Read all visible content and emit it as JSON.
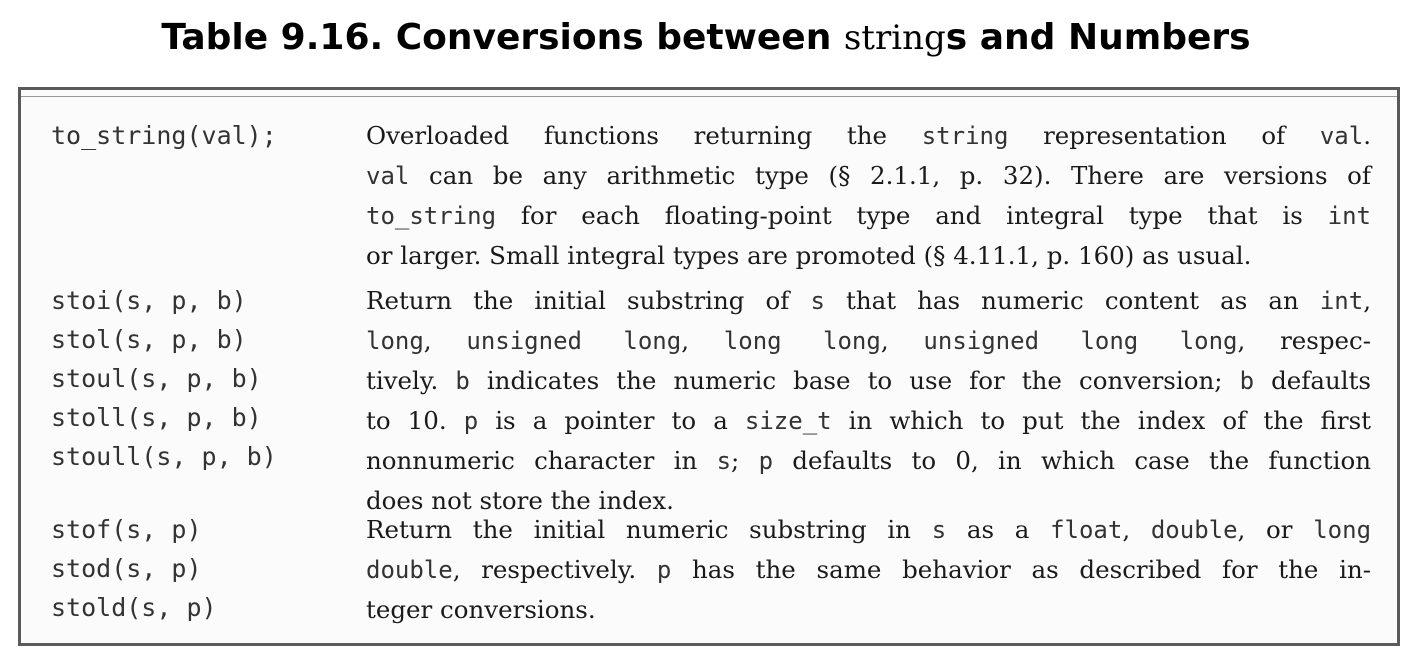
{
  "title": {
    "prefix": "Table 9.16. Conversions between ",
    "code_word": "string",
    "suffix": "s and Numbers"
  },
  "rows": [
    {
      "functions": [
        "to_string(val);"
      ],
      "description_lines": [
        [
          {
            "t": "Overloaded functions returning the "
          },
          {
            "c": "string"
          },
          {
            "t": " representation of "
          },
          {
            "c": "val"
          },
          {
            "t": "."
          }
        ],
        [
          {
            "c": "val"
          },
          {
            "t": " can be any arithmetic type (§ 2.1.1, p. 32). There are versions of"
          }
        ],
        [
          {
            "c": "to_string"
          },
          {
            "t": " for each floating-point type and integral type that is "
          },
          {
            "c": "int"
          }
        ],
        [
          {
            "t": "or larger. Small integral types are promoted (§ 4.11.1, p. 160) as usual."
          }
        ]
      ]
    },
    {
      "functions": [
        "stoi(s, p, b)",
        "stol(s, p, b)",
        "stoul(s, p, b)",
        "stoll(s, p, b)",
        "stoull(s, p, b)"
      ],
      "description_lines": [
        [
          {
            "t": "Return the initial substring of "
          },
          {
            "c": "s"
          },
          {
            "t": " that has numeric content as an "
          },
          {
            "c": "int"
          },
          {
            "t": ","
          }
        ],
        [
          {
            "c": "long"
          },
          {
            "t": ", "
          },
          {
            "c": "unsigned long"
          },
          {
            "t": ", "
          },
          {
            "c": "long long"
          },
          {
            "t": ", "
          },
          {
            "c": "unsigned long long"
          },
          {
            "t": ", respec-"
          }
        ],
        [
          {
            "t": "tively. "
          },
          {
            "c": "b"
          },
          {
            "t": " indicates the numeric base to use for the conversion; "
          },
          {
            "c": "b"
          },
          {
            "t": " defaults"
          }
        ],
        [
          {
            "t": "to 10. "
          },
          {
            "c": "p"
          },
          {
            "t": " is a pointer to a "
          },
          {
            "c": "size_t"
          },
          {
            "t": " in which to put the index of the first"
          }
        ],
        [
          {
            "t": "nonnumeric character in "
          },
          {
            "c": "s"
          },
          {
            "t": "; "
          },
          {
            "c": "p"
          },
          {
            "t": " defaults to 0, in which case the function"
          }
        ],
        [
          {
            "t": "does not store the index."
          }
        ]
      ]
    },
    {
      "functions": [
        "stof(s, p)",
        "stod(s, p)",
        "stold(s, p)"
      ],
      "description_lines": [
        [
          {
            "t": "Return the initial numeric substring in "
          },
          {
            "c": "s"
          },
          {
            "t": " as a "
          },
          {
            "c": "float"
          },
          {
            "t": ", "
          },
          {
            "c": "double"
          },
          {
            "t": ", or "
          },
          {
            "c": "long"
          }
        ],
        [
          {
            "c": "double"
          },
          {
            "t": ", respectively. "
          },
          {
            "c": "p"
          },
          {
            "t": " has the same behavior as described for the in-"
          }
        ],
        [
          {
            "t": "teger conversions."
          }
        ]
      ]
    }
  ]
}
